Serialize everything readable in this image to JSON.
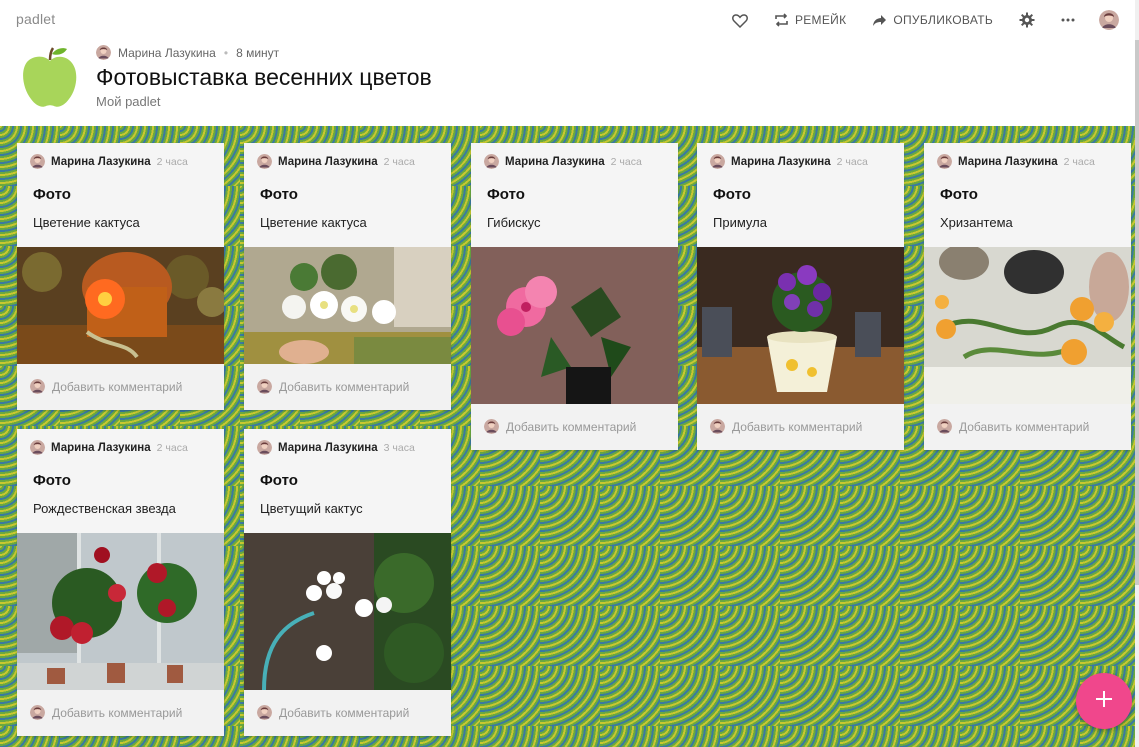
{
  "app": {
    "logo": "padlet"
  },
  "toolbar": {
    "remix_label": "РЕМЕЙК",
    "publish_label": "ОПУБЛИКОВАТЬ",
    "icons": [
      "heart-icon",
      "remix-icon",
      "share-arrow-icon",
      "gear-icon",
      "more-icon",
      "avatar"
    ]
  },
  "header": {
    "author": "Марина Лазукина",
    "time": "8 минут",
    "title": "Фотовыставка весенних цветов",
    "subtitle": "Мой padlet"
  },
  "cards": [
    {
      "author": "Марина Лазукина",
      "time": "2 часа",
      "title": "Фото",
      "body": "Цветение кактуса",
      "photo": "orange-cactus-flower",
      "comment_placeholder": "Добавить комментарий"
    },
    {
      "author": "Марина Лазукина",
      "time": "2 часа",
      "title": "Фото",
      "body": "Цветение кактуса",
      "photo": "white-cactus-flowers",
      "comment_placeholder": "Добавить комментарий"
    },
    {
      "author": "Марина Лазукина",
      "time": "2 часа",
      "title": "Фото",
      "body": "Гибискус",
      "photo": "pink-hibiscus",
      "comment_placeholder": "Добавить комментарий"
    },
    {
      "author": "Марина Лазукина",
      "time": "2 часа",
      "title": "Фото",
      "body": "Примула",
      "photo": "purple-primula",
      "comment_placeholder": "Добавить комментарий"
    },
    {
      "author": "Марина Лазукина",
      "time": "2 часа",
      "title": "Фото",
      "body": "Хризантема",
      "photo": "orange-chrysanthemum",
      "comment_placeholder": "Добавить комментарий"
    },
    {
      "author": "Марина Лазукина",
      "time": "2 часа",
      "title": "Фото",
      "body": "Рождественская звезда",
      "photo": "red-poinsettia",
      "comment_placeholder": "Добавить комментарий"
    },
    {
      "author": "Марина Лазукина",
      "time": "3 часа",
      "title": "Фото",
      "body": "Цветущий кактус",
      "photo": "white-flowering-cactus-garden",
      "comment_placeholder": "Добавить комментарий"
    }
  ],
  "colors": {
    "fab": "#f0478c",
    "wall_green": "#6aa840",
    "wall_yellow": "#c8c830",
    "wall_blue": "#3a7aa0",
    "apple": "#a8d55a"
  }
}
